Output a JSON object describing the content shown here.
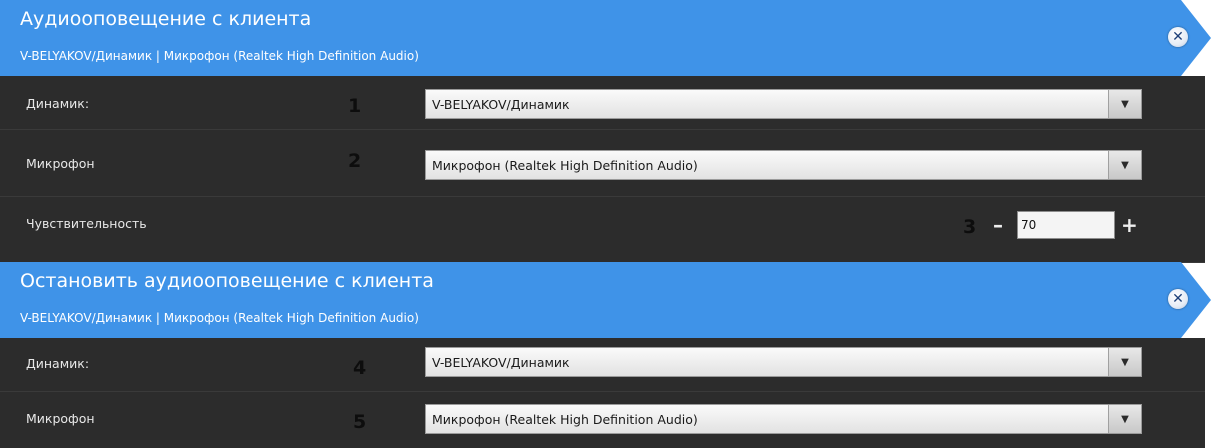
{
  "panels": [
    {
      "title": "Аудиооповещение с клиента",
      "subtitle": "V-BELYAKOV/Динамик | Микрофон (Realtek High Definition Audio)",
      "rows": [
        {
          "label": "Динамик:",
          "marker": "1",
          "value": "V-BELYAKOV/Динамик"
        },
        {
          "label": "Микрофон",
          "marker": "2",
          "value": "Микрофон (Realtek High Definition Audio)"
        }
      ],
      "sensitivity": {
        "label": "Чувствительность",
        "marker": "3",
        "value": "70",
        "minus": "–",
        "plus": "+"
      }
    },
    {
      "title": "Остановить аудиооповещение с клиента",
      "subtitle": "V-BELYAKOV/Динамик | Микрофон (Realtek High Definition Audio)",
      "rows": [
        {
          "label": "Динамик:",
          "marker": "4",
          "value": "V-BELYAKOV/Динамик"
        },
        {
          "label": "Микрофон",
          "marker": "5",
          "value": "Микрофон (Realtek High Definition Audio)"
        }
      ]
    }
  ],
  "icons": {
    "close": "close-icon",
    "dropdown": "chevron-down-icon"
  },
  "colors": {
    "header": "#3f93e8",
    "row_bg": "#2c2c2c",
    "marker": "#0d0d0d"
  }
}
